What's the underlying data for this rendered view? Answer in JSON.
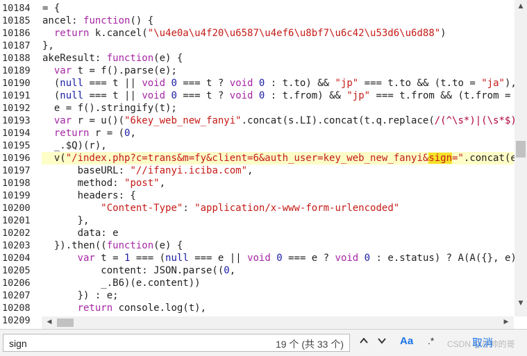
{
  "lines": [
    {
      "n": "10184",
      "html": "= {"
    },
    {
      "n": "10185",
      "html": "ancel: <span class='kw'>function</span>() {"
    },
    {
      "n": "10186",
      "html": "  <span class='kw'>return</span> k.cancel(<span class='str'>\"\\u4e0a\\u4f20\\u6587\\u4ef6\\u8bf7\\u6c42\\u53d6\\u6d88\"</span>)"
    },
    {
      "n": "10187",
      "html": "},"
    },
    {
      "n": "10188",
      "html": "akeResult: <span class='kw'>function</span>(e) {"
    },
    {
      "n": "10189",
      "html": "  <span class='kw'>var</span> t = f().parse(e);"
    },
    {
      "n": "10190",
      "html": "  (<span class='kb'>null</span> === t || <span class='kw'>void</span> <span class='kb'>0</span> === t ? <span class='kw'>void</span> <span class='kb'>0</span> : t.to) &amp;&amp; <span class='str'>\"jp\"</span> === t.to &amp;&amp; (t.to = <span class='str'>\"ja\"</span>),"
    },
    {
      "n": "10191",
      "html": "  (<span class='kb'>null</span> === t || <span class='kw'>void</span> <span class='kb'>0</span> === t ? <span class='kw'>void</span> <span class='kb'>0</span> : t.from) &amp;&amp; <span class='str'>\"jp\"</span> === t.from &amp;&amp; (t.from ="
    },
    {
      "n": "10192",
      "html": "  e = f().stringify(t);"
    },
    {
      "n": "10193",
      "html": "  <span class='kw'>var</span> r = u()(<span class='str'>\"6key_web_new_fanyi\"</span>.concat(s.LI).concat(t.q.replace(<span class='re'>/(^\\s*)|(\\s*$)</span>"
    },
    {
      "n": "10194",
      "html": "  <span class='kw'>return</span> r = (<span class='kb'>0</span>,"
    },
    {
      "n": "10195",
      "html": "  _.$Q)(r),"
    },
    {
      "n": "10196",
      "html": "  v(<span class='str'>\"/index.php?c=trans&amp;m=fy&amp;client=6&amp;auth_user=key_web_new_fanyi&amp;<span class='mark'>sign</span>=\"</span>.concat(e"
    },
    {
      "n": "10197",
      "html": "      baseURL: <span class='str'>\"//ifanyi.iciba.com\"</span>,"
    },
    {
      "n": "10198",
      "html": "      method: <span class='str'>\"post\"</span>,"
    },
    {
      "n": "10199",
      "html": "      headers: {"
    },
    {
      "n": "10200",
      "html": "          <span class='str'>\"Content-Type\"</span>: <span class='str'>\"application/x-www-form-urlencoded\"</span>"
    },
    {
      "n": "10201",
      "html": "      },"
    },
    {
      "n": "10202",
      "html": "      data: e"
    },
    {
      "n": "10203",
      "html": "  }).then((<span class='kw'>function</span>(e) {"
    },
    {
      "n": "10204",
      "html": "      <span class='kw'>var</span> t = <span class='kb'>1</span> === (<span class='kb'>null</span> === e || <span class='kw'>void</span> <span class='kb'>0</span> === e ? <span class='kw'>void</span> <span class='kb'>0</span> : e.status) ? A(A({}, e)"
    },
    {
      "n": "10205",
      "html": "          content: JSON.parse((<span class='kb'>0</span>,"
    },
    {
      "n": "10206",
      "html": "          _.B6)(e.content))"
    },
    {
      "n": "10207",
      "html": "      }) : e;"
    },
    {
      "n": "10208",
      "html": "      <span class='kw'>return</span> console.log(t),"
    },
    {
      "n": "10209",
      "html": ""
    }
  ],
  "search": {
    "value": "sign",
    "count": "19 个 (共 33 个)",
    "match_case_label": "Aa",
    "regex_label": ".*",
    "cancel_label": "取消",
    "watermark": "CSDN @小帅的哥"
  }
}
